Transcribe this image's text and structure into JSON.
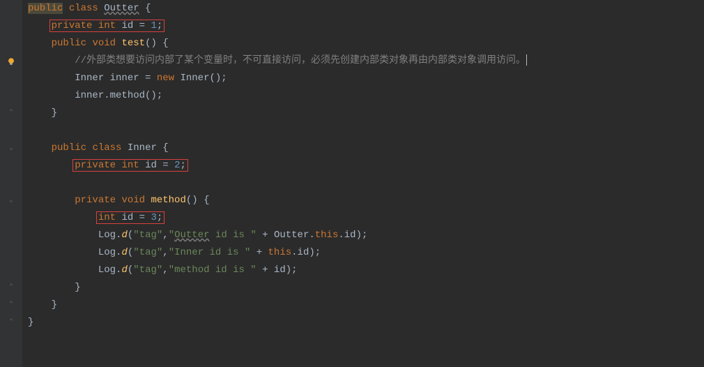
{
  "code": {
    "l1": {
      "kw_public": "public",
      "kw_class": "class",
      "cls": "Outter",
      "br": "{"
    },
    "l2": {
      "kw_private": "private",
      "kw_int": "int",
      "var": "id",
      "eq": " = ",
      "val": "1",
      "sc": ";"
    },
    "l3": {
      "kw_public": "public",
      "kw_void": "void",
      "fn": "test",
      "par": "()",
      "br": " {"
    },
    "l4": {
      "comment": "//外部类想要访问内部了某个变量时，不可直接访问，必须先创建内部类对象再由内部类对象调用访问。"
    },
    "l5": {
      "txt1": "Inner inner = ",
      "kw_new": "new",
      "txt2": " Inner();"
    },
    "l6": {
      "txt": "inner.method();"
    },
    "l7": {
      "br": "}"
    },
    "l8": {
      "blank": ""
    },
    "l9": {
      "kw_public": "public",
      "kw_class": "class",
      "cls": "Inner",
      "br": " {"
    },
    "l10": {
      "kw_private": "private",
      "kw_int": "int",
      "var": "id",
      "eq": " = ",
      "val": "2",
      "sc": ";"
    },
    "l11": {
      "blank": ""
    },
    "l12": {
      "kw_private": "private",
      "kw_void": "void",
      "fn": "method",
      "par": "()",
      "br": " {"
    },
    "l13": {
      "kw_int": "int",
      "var": "id",
      "eq": " = ",
      "val": "3",
      "sc": ";"
    },
    "l14": {
      "cls": "Log",
      "dot": ".",
      "m": "d",
      "p1": "(",
      "s1": "\"tag\"",
      "c": ",",
      "s2a": "\"",
      "s2u": "Outter",
      " s2b": " id is \"",
      "plus": " + Outter.",
      "kw_this": "this",
      "rest": ".id);"
    },
    "l15": {
      "cls": "Log",
      "dot": ".",
      "m": "d",
      "p1": "(",
      "s1": "\"tag\"",
      "c": ",",
      "s2": "\"Inner id is \"",
      "plus": " + ",
      "kw_this": "this",
      "rest": ".id);"
    },
    "l16": {
      "cls": "Log",
      "dot": ".",
      "m": "d",
      "p1": "(",
      "s1": "\"tag\"",
      "c": ",",
      "s2": "\"method id is \"",
      "plus": " + id);"
    },
    "l17": {
      "br": "}"
    },
    "l18": {
      "br": "}"
    },
    "l19": {
      "br": "}"
    }
  },
  "icons": {
    "bulb": "bulb-icon"
  }
}
